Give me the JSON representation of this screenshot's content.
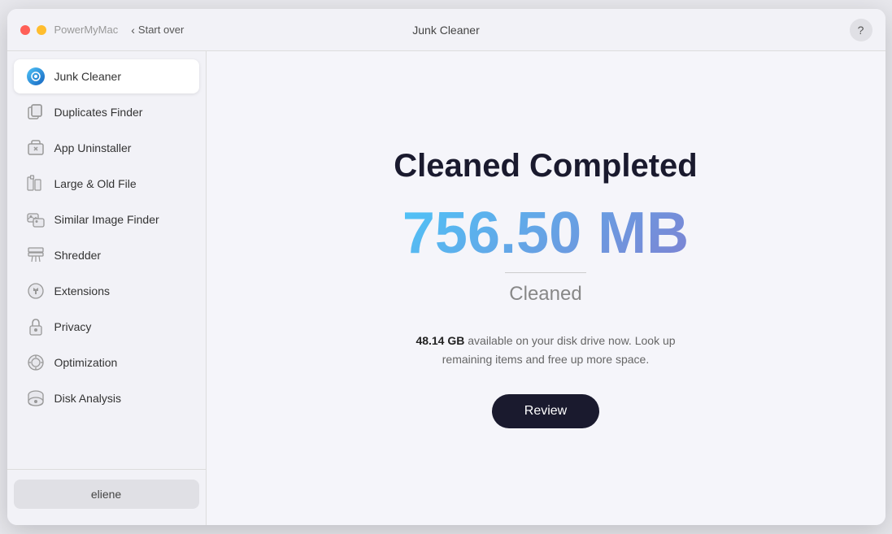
{
  "window": {
    "title": "Junk Cleaner",
    "app_name": "PowerMyMac",
    "start_over_label": "Start over"
  },
  "help_button_label": "?",
  "sidebar": {
    "items": [
      {
        "id": "junk-cleaner",
        "label": "Junk Cleaner",
        "active": true,
        "icon": "junk-icon"
      },
      {
        "id": "duplicates-finder",
        "label": "Duplicates Finder",
        "active": false,
        "icon": "duplicates-icon"
      },
      {
        "id": "app-uninstaller",
        "label": "App Uninstaller",
        "active": false,
        "icon": "uninstaller-icon"
      },
      {
        "id": "large-old-file",
        "label": "Large & Old File",
        "active": false,
        "icon": "large-file-icon"
      },
      {
        "id": "similar-image-finder",
        "label": "Similar Image Finder",
        "active": false,
        "icon": "image-icon"
      },
      {
        "id": "shredder",
        "label": "Shredder",
        "active": false,
        "icon": "shredder-icon"
      },
      {
        "id": "extensions",
        "label": "Extensions",
        "active": false,
        "icon": "extensions-icon"
      },
      {
        "id": "privacy",
        "label": "Privacy",
        "active": false,
        "icon": "privacy-icon"
      },
      {
        "id": "optimization",
        "label": "Optimization",
        "active": false,
        "icon": "optimization-icon"
      },
      {
        "id": "disk-analysis",
        "label": "Disk Analysis",
        "active": false,
        "icon": "disk-icon"
      }
    ],
    "user": {
      "name": "eliene"
    }
  },
  "main": {
    "completion_title": "Cleaned Completed",
    "cleaned_size": "756.50 MB",
    "cleaned_label": "Cleaned",
    "disk_info_bold": "48.14 GB",
    "disk_info_text": " available on your disk drive now. Look up remaining items and free up more space.",
    "review_button": "Review"
  }
}
